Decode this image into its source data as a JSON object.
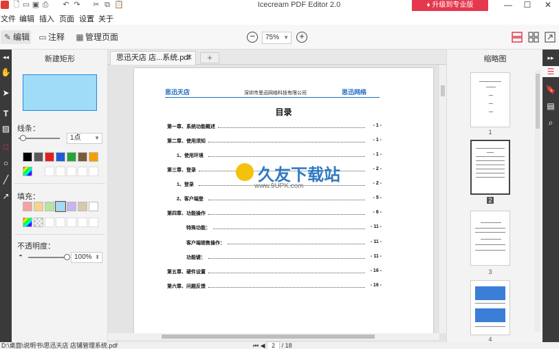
{
  "window": {
    "title": "Icecream PDF Editor 2.0",
    "upgrade_label": "升级到专业版",
    "minimize": "—",
    "maximize": "☐",
    "close": "✕"
  },
  "menu": [
    "文件",
    "编辑",
    "插入",
    "页面",
    "设置",
    "关于"
  ],
  "toolbar": {
    "modes": [
      "编辑",
      "注释",
      "管理页面"
    ],
    "zoom": "75%"
  },
  "props": {
    "title": "新建矩形",
    "stroke_label": "线条：",
    "stroke_width": "1点",
    "fill_label": "填充：",
    "opacity_label": "不透明度：",
    "opacity_value": "100%",
    "stroke_colors": [
      "#000000",
      "#5a5a5a",
      "#e02020",
      "#1e5bd8",
      "#27a33b",
      "#7a5a3a",
      "#f5a000"
    ],
    "fill_colors": [
      "#f2a3a3",
      "#f7d38a",
      "#b7e4a0",
      "#9fdcf8",
      "#c8b4f0",
      "#d9c7b0",
      "#ffffff"
    ]
  },
  "tab": {
    "label": "思迅天店 店...系统.pdf",
    "close": "✕",
    "add": "+"
  },
  "document": {
    "logo_left": "思迅天店",
    "company": "深圳市思迅网络科技有限公司",
    "logo_right": "思迅网络",
    "toc_title": "目录",
    "entries": [
      {
        "text": "第一章、系统功能概述",
        "page": "- 1 -"
      },
      {
        "text": "第二章、使用须知",
        "page": "- 1 -"
      },
      {
        "text": "1、使用环境",
        "page": "- 1 -"
      },
      {
        "text": "第三章、登录",
        "page": "- 2 -"
      },
      {
        "text": "1、登录",
        "page": "- 2 -"
      },
      {
        "text": "2、客户端登",
        "page": "- 5 -"
      },
      {
        "text": "第四章、功能操作",
        "page": "- 6 -"
      },
      {
        "text": "特殊功能：",
        "page": "- 11 -"
      },
      {
        "text": "客户端销售操作：",
        "page": "- 11 -"
      },
      {
        "text": "功能键：",
        "page": "- 11 -"
      },
      {
        "text": "第五章、硬件设置",
        "page": "- 16 -"
      },
      {
        "text": "第六章、问题反馈",
        "page": "- 16 -"
      }
    ],
    "watermark": "久友下载站",
    "watermark_url": "www.9UPK.com"
  },
  "thumbnails": {
    "title": "缩略图",
    "pages": [
      "1",
      "2",
      "3",
      "4"
    ]
  },
  "status": {
    "path": "D:\\桌面\\说明书\\思迅天店 店铺管理系统.pdf",
    "page_current": "2",
    "page_total": "/ 18"
  }
}
